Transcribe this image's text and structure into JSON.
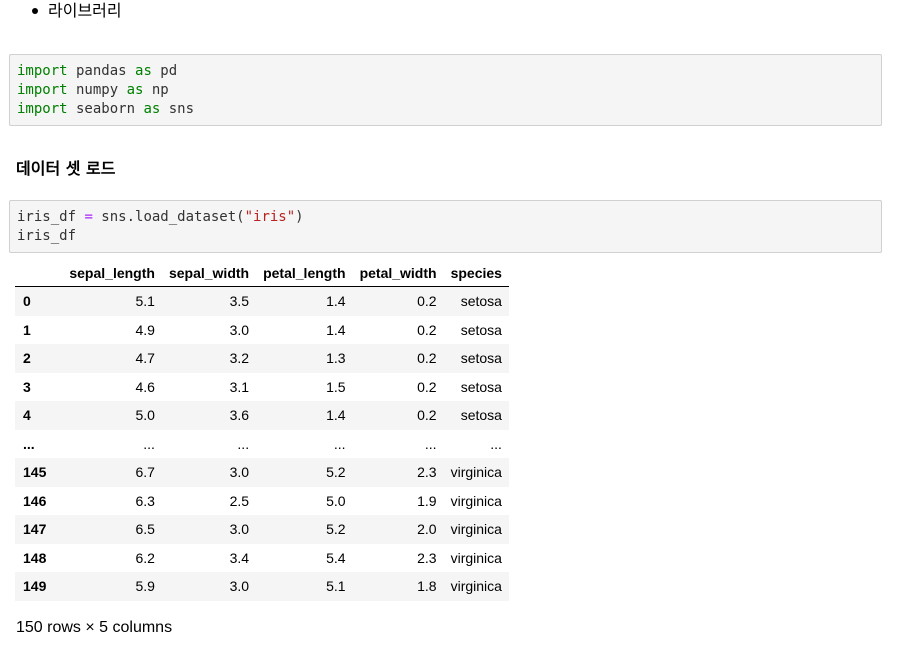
{
  "bullet": {
    "items": [
      "라이브러리"
    ]
  },
  "cell1": {
    "lines": [
      {
        "kw1": "import",
        "mod": " pandas ",
        "kw2": "as",
        "alias": " pd"
      },
      {
        "kw1": "import",
        "mod": " numpy ",
        "kw2": "as",
        "alias": " np"
      },
      {
        "kw1": "import",
        "mod": " seaborn ",
        "kw2": "as",
        "alias": " sns"
      }
    ]
  },
  "section": {
    "heading": "데이터 셋 로드"
  },
  "cell2": {
    "line1_var": "iris_df ",
    "line1_op": "=",
    "line1_call": " sns.load_dataset(",
    "line1_str": "\"iris\"",
    "line1_close": ")",
    "line2": "iris_df"
  },
  "dataframe": {
    "index_header": "",
    "columns": [
      "sepal_length",
      "sepal_width",
      "petal_length",
      "petal_width",
      "species"
    ],
    "rows": [
      {
        "index": "0",
        "values": [
          "5.1",
          "3.5",
          "1.4",
          "0.2",
          "setosa"
        ]
      },
      {
        "index": "1",
        "values": [
          "4.9",
          "3.0",
          "1.4",
          "0.2",
          "setosa"
        ]
      },
      {
        "index": "2",
        "values": [
          "4.7",
          "3.2",
          "1.3",
          "0.2",
          "setosa"
        ]
      },
      {
        "index": "3",
        "values": [
          "4.6",
          "3.1",
          "1.5",
          "0.2",
          "setosa"
        ]
      },
      {
        "index": "4",
        "values": [
          "5.0",
          "3.6",
          "1.4",
          "0.2",
          "setosa"
        ]
      },
      {
        "index": "...",
        "values": [
          "...",
          "...",
          "...",
          "...",
          "..."
        ]
      },
      {
        "index": "145",
        "values": [
          "6.7",
          "3.0",
          "5.2",
          "2.3",
          "virginica"
        ]
      },
      {
        "index": "146",
        "values": [
          "6.3",
          "2.5",
          "5.0",
          "1.9",
          "virginica"
        ]
      },
      {
        "index": "147",
        "values": [
          "6.5",
          "3.0",
          "5.2",
          "2.0",
          "virginica"
        ]
      },
      {
        "index": "148",
        "values": [
          "6.2",
          "3.4",
          "5.4",
          "2.3",
          "virginica"
        ]
      },
      {
        "index": "149",
        "values": [
          "5.9",
          "3.0",
          "5.1",
          "1.8",
          "virginica"
        ]
      }
    ],
    "shape_text": "150 rows × 5 columns"
  }
}
